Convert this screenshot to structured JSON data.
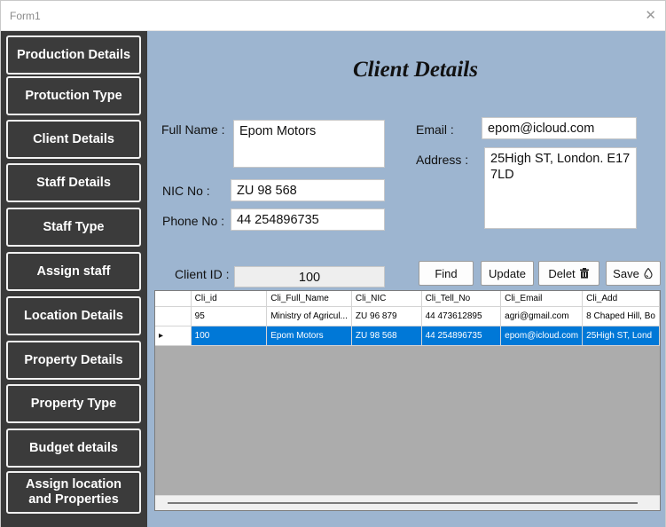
{
  "window": {
    "title": "Form1",
    "close_glyph": "✕"
  },
  "sidebar": {
    "items": [
      "Production Details",
      "Protuction Type",
      "Client Details",
      "Staff Details",
      "Staff Type",
      "Assign staff",
      "Location Details",
      "Property Details",
      "Property Type",
      "Budget details",
      "Assign location and Properties"
    ]
  },
  "form": {
    "heading": "Client Details",
    "full_name_label": "Full Name :",
    "full_name_value": "Epom Motors",
    "nic_label": "NIC No :",
    "nic_value": "ZU 98 568",
    "phone_label": "Phone No :",
    "phone_value": "44 254896735",
    "email_label": "Email :",
    "email_value": "epom@icloud.com",
    "address_label": "Address :",
    "address_value": "25High ST, London. E17 7LD",
    "client_id_label": "Client ID :",
    "client_id_value": "100"
  },
  "buttons": {
    "find": "Find",
    "update": "Update",
    "delete": "Delet",
    "save": "Save"
  },
  "grid": {
    "columns": [
      "Cli_id",
      "Cli_Full_Name",
      "Cli_NIC",
      "Cli_Tell_No",
      "Cli_Email",
      "Cli_Add"
    ],
    "rows": [
      [
        "95",
        "Ministry of Agricul...",
        "ZU 96 879",
        "44 473612895",
        "agri@gmail.com",
        "8 Chaped Hill, Bo"
      ],
      [
        "100",
        "Epom Motors",
        "ZU 98 568",
        "44 254896735",
        "epom@icloud.com",
        "25High ST, Lond"
      ]
    ],
    "selected_row_index": 1,
    "row_indicator": "▸"
  },
  "colors": {
    "sidebar_bg": "#3a3a3a",
    "content_bg": "#9db5d0",
    "selection": "#0078d7"
  }
}
